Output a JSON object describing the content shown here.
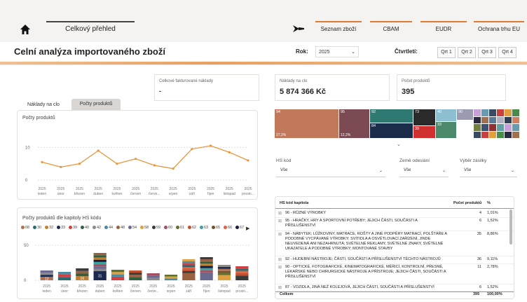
{
  "nav": {
    "tab_overview": "Celkový přehled",
    "buttons": [
      "Seznam zboží",
      "CBAM",
      "EUDR",
      "Ochrana trhu EU"
    ]
  },
  "page": {
    "title": "Celní analýza importovaného zboží"
  },
  "filters": {
    "year_label": "Rok:",
    "year_value": "2025",
    "quarter_label": "Čtvrtletí:",
    "quarters": [
      "Qrt 1",
      "Qrt 2",
      "Qrt 3",
      "Qrt 4"
    ]
  },
  "cards": {
    "invoiced_label": "Celkové fakturované náklady",
    "invoiced_value": "-",
    "duty_label": "Náklady na clo",
    "duty_value": "5 874 366 Kč",
    "products_label": "Počet produktů",
    "products_value": "395"
  },
  "tabs": {
    "t1": "Náklady na clo",
    "t2": "Počty produktů"
  },
  "line_chart": {
    "title": "Počty produktů",
    "y_ticks": [
      "10",
      "0"
    ],
    "months": [
      "leden",
      "únor",
      "březen",
      "duben",
      "květen",
      "červen",
      "červe...",
      "srpen",
      "září",
      "říjen",
      "listopad",
      "prosin..."
    ],
    "year": "2025",
    "values": [
      5.5,
      4,
      5,
      9,
      5,
      6.5,
      4.5,
      3.5,
      9.5,
      10.5,
      8.5,
      6
    ]
  },
  "bar_chart": {
    "title": "Počty produktů dle kapitoly HS kódu",
    "legend": [
      "08",
      "30",
      "32",
      "33",
      "39",
      "40",
      "42",
      "44",
      "48",
      "54",
      "58",
      "59",
      "60",
      "61",
      "62",
      "63",
      "65",
      "66",
      "67"
    ],
    "legend_colors": [
      "#b07050",
      "#2a6a70",
      "#c08030",
      "#1a2a50",
      "#d04040",
      "#306040",
      "#8a8a8a",
      "#4a8aa0",
      "#9a6040",
      "#6a6a90",
      "#e0a040",
      "#3a3a3a",
      "#a05060",
      "#607030",
      "#c05030",
      "#40a0a0",
      "#705030",
      "#e06040",
      "#1a1a3a"
    ],
    "y_ticks": [
      "50",
      "0"
    ],
    "months": [
      "leden",
      "únor",
      "březen",
      "duben",
      "květen",
      "červen",
      "červe...",
      "srpen",
      "září",
      "říjen",
      "listopad",
      "prosin..."
    ],
    "year": "2025",
    "totals": [
      14,
      12,
      17,
      39,
      15,
      14,
      10,
      8,
      30,
      33,
      22,
      20
    ],
    "labels": [
      "13",
      "",
      "16",
      "31",
      "",
      "",
      "",
      "",
      "",
      "",
      "",
      ""
    ]
  },
  "treemap": {
    "blocks": [
      {
        "label": "94",
        "sub": "27,2%",
        "color": "#c2785a"
      },
      {
        "label": "95",
        "sub": "12,2%",
        "color": "#7c4a52"
      },
      {
        "label": "92",
        "sub": "",
        "color": "#2e7a72"
      },
      {
        "label": "84",
        "sub": "",
        "color": "#1a2c4a"
      },
      {
        "label": "73",
        "sub": "",
        "color": "#2a2a2a"
      },
      {
        "label": "39",
        "sub": "",
        "color": "#d03030"
      },
      {
        "label": "40",
        "sub": "",
        "color": "#8cc0d0"
      },
      {
        "label": "33",
        "sub": "",
        "color": "#4a8a6a"
      },
      {
        "label": "90",
        "sub": "",
        "color": "#9a9ab0"
      }
    ]
  },
  "dropdowns": {
    "hs_label": "HS kód",
    "hs_value": "Vše",
    "country_label": "Země odeslání",
    "country_value": "Vše",
    "ship_label": "Výběr zásilky",
    "ship_value": "Vše"
  },
  "table": {
    "headers": [
      "HS kód kapitola",
      "Počet produktů",
      "%"
    ],
    "rows": [
      {
        "name": "96 - RŮZNÉ VÝROBKY",
        "count": "4",
        "pct": "1,01%"
      },
      {
        "name": "95 - HRAČKY, HRY A SPORTOVNÍ POTŘEBY; JEJICH ČÁSTI, SOUČÁSTI A PŘÍSLUŠENSTVÍ",
        "count": "6",
        "pct": "1,52%"
      },
      {
        "name": "94 - NÁBYTEK; LŮŽKOVINY, MATRACE, ROŠTY A JINÉ PODPĚRY MATRACÍ, POLŠTÁŘE A PODOBNÉ VYCPÁVANÉ VÝROBKY; SVÍTIDLA A OSVĚTLOVACÍ ZAŘÍZENÍ, JINDE NEUVEDENÁ ANI NEZAHRNUTÁ; SVĚTELNÉ REKLAMY, SVĚTELNÉ ZNAKY, SVĚTELNÉ UKAZATELE A PODOBNÉ VÝROBKY; MONTOVANÉ STAVBY",
        "count": "35",
        "pct": "8,86%"
      },
      {
        "name": "92 - HUDEBNÍ NÁSTROJE; ČÁSTI, SOUČÁSTI A PŘÍSLUŠENSTVÍ TĚCHTO NÁSTROJŮ",
        "count": "36",
        "pct": "9,11%"
      },
      {
        "name": "90 - OPTICKÉ, FOTOGRAFICKÉ, KINEMATOGRAFICKÉ, MĚŘICÍ, KONTROLNÍ, PŘESNÉ, LÉKAŘSKÉ NEBO CHIRURGICKÉ NÁSTROJE A PŘÍSTROJE; JEJICH ČÁSTI, SOUČÁSTI A PŘÍSLUŠENSTVÍ",
        "count": "11",
        "pct": "2,78%"
      },
      {
        "name": "87 - VOZIDLA, JINÁ NEŽ KOLEJOVÁ, JEJICH ČÁSTI, SOUČÁSTI A PŘÍSLUŠENSTVÍ",
        "count": "6",
        "pct": "1,52%"
      }
    ],
    "total_label": "Celkem",
    "total_count": "395",
    "total_pct": "100,00%"
  }
}
